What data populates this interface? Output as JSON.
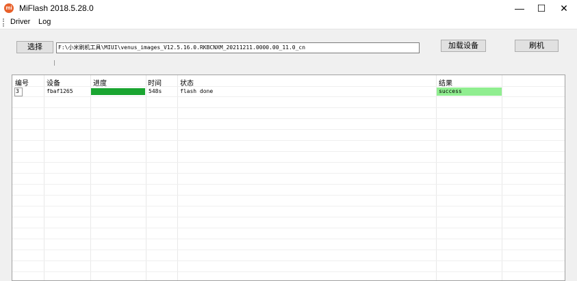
{
  "window": {
    "title": "MiFlash 2018.5.28.0",
    "controls": {
      "minimize": "—",
      "maximize": "☐",
      "close": "✕"
    }
  },
  "menu": {
    "items": [
      "Driver",
      "Log"
    ]
  },
  "toolbar": {
    "select_label": "选择",
    "path_value": "F:\\小米刷机工具\\MIUI\\venus_images_V12.5.16.0.RKBCNXM_20211211.0000.00_11.0_cn",
    "load_devices_label": "加载设备",
    "flash_label": "刷机"
  },
  "table": {
    "headers": [
      "编号",
      "设备",
      "进度",
      "时间",
      "状态",
      "结果"
    ],
    "rows": [
      {
        "id": "3",
        "device": "fbaf1265",
        "progress": 1.0,
        "time": "548s",
        "status": "flash done",
        "result": "success"
      }
    ]
  },
  "colors": {
    "progress": "#1aa531",
    "success": "#90ee90"
  }
}
